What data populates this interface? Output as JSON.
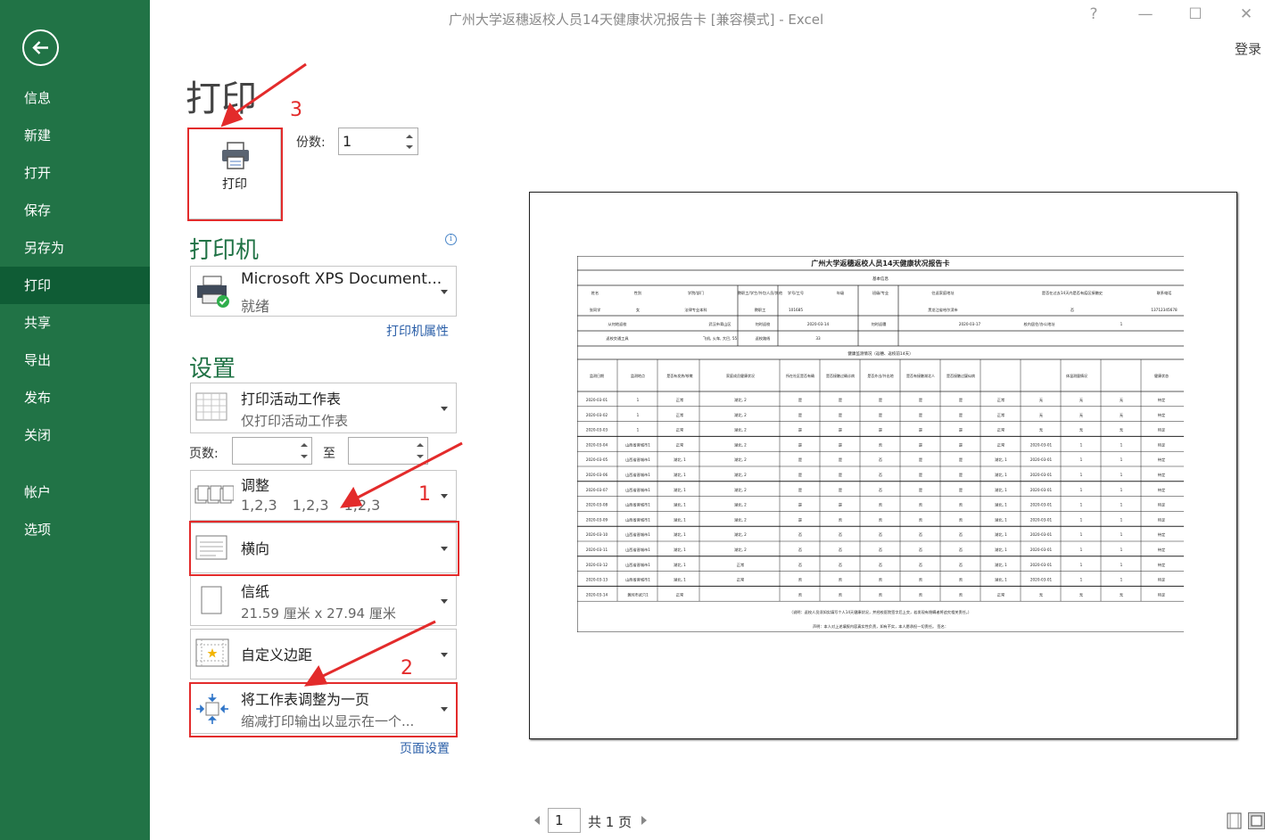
{
  "window": {
    "title": "广州大学返穗返校人员14天健康状况报告卡  [兼容模式] - Excel",
    "help": "?",
    "minimize": "—",
    "maximize": "☐",
    "close": "✕",
    "login": "登录"
  },
  "sidebar": {
    "back_icon": "back-arrow-icon",
    "items": [
      {
        "label": "信息"
      },
      {
        "label": "新建"
      },
      {
        "label": "打开"
      },
      {
        "label": "保存"
      },
      {
        "label": "另存为"
      },
      {
        "label": "打印",
        "active": true
      },
      {
        "label": "共享"
      },
      {
        "label": "导出"
      },
      {
        "label": "发布"
      },
      {
        "label": "关闭"
      },
      {
        "label": "帐户"
      },
      {
        "label": "选项"
      }
    ]
  },
  "print": {
    "heading": "打印",
    "button_label": "打印",
    "copies_label": "份数:",
    "copies_value": "1"
  },
  "printer": {
    "section_title": "打印机",
    "name": "Microsoft XPS Document...",
    "status": "就绪",
    "properties_link": "打印机属性"
  },
  "settings": {
    "section_title": "设置",
    "scope": {
      "title": "打印活动工作表",
      "subtitle": "仅打印活动工作表"
    },
    "pages_label": "页数:",
    "to_label": "至",
    "collate": {
      "title": "调整",
      "subtitle": "1,2,3    1,2,3    1,2,3"
    },
    "orientation": {
      "title": "横向"
    },
    "paper": {
      "title": "信纸",
      "subtitle": "21.59 厘米 x 27.94 厘米"
    },
    "margins": {
      "title": "自定义边距"
    },
    "scaling": {
      "title": "将工作表调整为一页",
      "subtitle": "缩减打印输出以显示在一个..."
    },
    "page_setup_link": "页面设置"
  },
  "preview": {
    "page_current": "1",
    "page_total": "共 1 页",
    "sheet": {
      "title": "广州大学返穗返校人员14天健康状况报告卡",
      "basic_info_header": "基本信息",
      "row_a": [
        "姓名",
        "性别",
        "学院/部门",
        "教职工/学生/外包人员/其他",
        "学号/工号",
        "年级",
        "班级/专业",
        "往返家庭地址",
        "是否在过去14天内是否有疫区接触史",
        "联系电话"
      ],
      "row_b": [
        "张同学",
        "女",
        "法律专业本科",
        "教职工",
        "101685",
        "",
        "",
        "黑龙江省哈尔滨市",
        "否",
        "13712345678"
      ],
      "row_c": [
        "从何地返校",
        "武汉市青山区",
        "何时返校",
        "2020-03-14",
        "何时返穗",
        "2020-03-17",
        "校内居住/办公地址",
        "1"
      ],
      "row_d": [
        "返校交通工具",
        "飞机, 火车, 大巴, 55",
        "返校路线",
        "33"
      ],
      "health_header": "健康监测情况（返穗、返校前14天）",
      "col_headers": [
        "监测日期",
        "监测地点",
        "是否有发热/咳嗽等症状",
        "家庭成员健康状况",
        "所在社区是否有确诊病例",
        "是否接触过确诊病例",
        "是否外出/外出地点",
        "是否有接触湖北人员",
        "是否接触过疑似病例",
        "体温测量情况",
        "健康状态"
      ],
      "rows": [
        [
          "2020-03-01",
          "1",
          "正常",
          "湖北, 2",
          "是",
          "是",
          "是",
          "是",
          "是",
          "正常",
          "无",
          "无",
          "无",
          "待定"
        ],
        [
          "2020-03-02",
          "1",
          "正常",
          "湖北, 2",
          "是",
          "是",
          "是",
          "是",
          "是",
          "正常",
          "无",
          "无",
          "无",
          "待定"
        ],
        [
          "2020-03-03",
          "1",
          "正常",
          "湖北, 2",
          "是",
          "是",
          "是",
          "是",
          "是",
          "正常",
          "无",
          "无",
          "无",
          "待定"
        ],
        [
          "2020-03-04",
          "山西省晋城市1",
          "正常",
          "湖北, 2",
          "是",
          "是",
          "否",
          "是",
          "是",
          "正常",
          "2020-03-01",
          "1",
          "1",
          "待定"
        ],
        [
          "2020-03-05",
          "山西省晋城市1",
          "湖北, 1",
          "湖北, 2",
          "是",
          "是",
          "否",
          "是",
          "是",
          "湖北, 1",
          "2020-03-01",
          "1",
          "1",
          "待定"
        ],
        [
          "2020-03-06",
          "山西省晋城市1",
          "湖北, 1",
          "湖北, 2",
          "是",
          "是",
          "否",
          "是",
          "是",
          "湖北, 1",
          "2020-03-01",
          "1",
          "1",
          "待定"
        ],
        [
          "2020-03-07",
          "山西省晋城市1",
          "湖北, 1",
          "湖北, 2",
          "是",
          "是",
          "否",
          "是",
          "是",
          "湖北, 1",
          "2020-03-01",
          "1",
          "1",
          "待定"
        ],
        [
          "2020-03-08",
          "山西省晋城市1",
          "湖北, 1",
          "湖北, 2",
          "是",
          "是",
          "否",
          "否",
          "否",
          "湖北, 1",
          "2020-03-01",
          "1",
          "1",
          "待定"
        ],
        [
          "2020-03-09",
          "山西省晋城市1",
          "湖北, 1",
          "湖北, 2",
          "是",
          "否",
          "否",
          "否",
          "否",
          "湖北, 1",
          "2020-03-01",
          "1",
          "1",
          "待定"
        ],
        [
          "2020-03-10",
          "山西省晋城市1",
          "湖北, 1",
          "湖北, 2",
          "否",
          "否",
          "否",
          "否",
          "否",
          "湖北, 1",
          "2020-03-01",
          "1",
          "1",
          "待定"
        ],
        [
          "2020-03-11",
          "山西省晋城市1",
          "湖北, 1",
          "湖北, 2",
          "否",
          "否",
          "否",
          "否",
          "否",
          "湖北, 1",
          "2020-03-01",
          "1",
          "1",
          "待定"
        ],
        [
          "2020-03-12",
          "山西省晋城市1",
          "湖北, 1",
          "正常",
          "否",
          "否",
          "否",
          "否",
          "否",
          "湖北, 1",
          "2020-03-01",
          "1",
          "1",
          "待定"
        ],
        [
          "2020-03-13",
          "山西省晋城市1",
          "湖北, 1",
          "正常",
          "否",
          "否",
          "否",
          "否",
          "否",
          "湖北, 1",
          "2020-03-01",
          "1",
          "1",
          "待定"
        ],
        [
          "2020-03-14",
          "黄冈市武穴1",
          "正常",
          "",
          "否",
          "否",
          "否",
          "否",
          "否",
          "正常",
          "无",
          "无",
          "无",
          "待定"
        ]
      ],
      "note": "（说明：返校人员须如实填写个人14天健康状况，并经校医院签字后上交，若发现有隐瞒者将追究相关责任。）",
      "declaration": "声明：本人对上述填报内容真实性负责，如有不实，本人愿承担一切责任。    签名："
    }
  },
  "annotations": {
    "num1": "1",
    "num2": "2",
    "num3": "3",
    "color": "#e32b2b"
  },
  "colors": {
    "accent": "#217346",
    "accent_dark": "#0f5c35",
    "link": "#2b5fa8"
  }
}
